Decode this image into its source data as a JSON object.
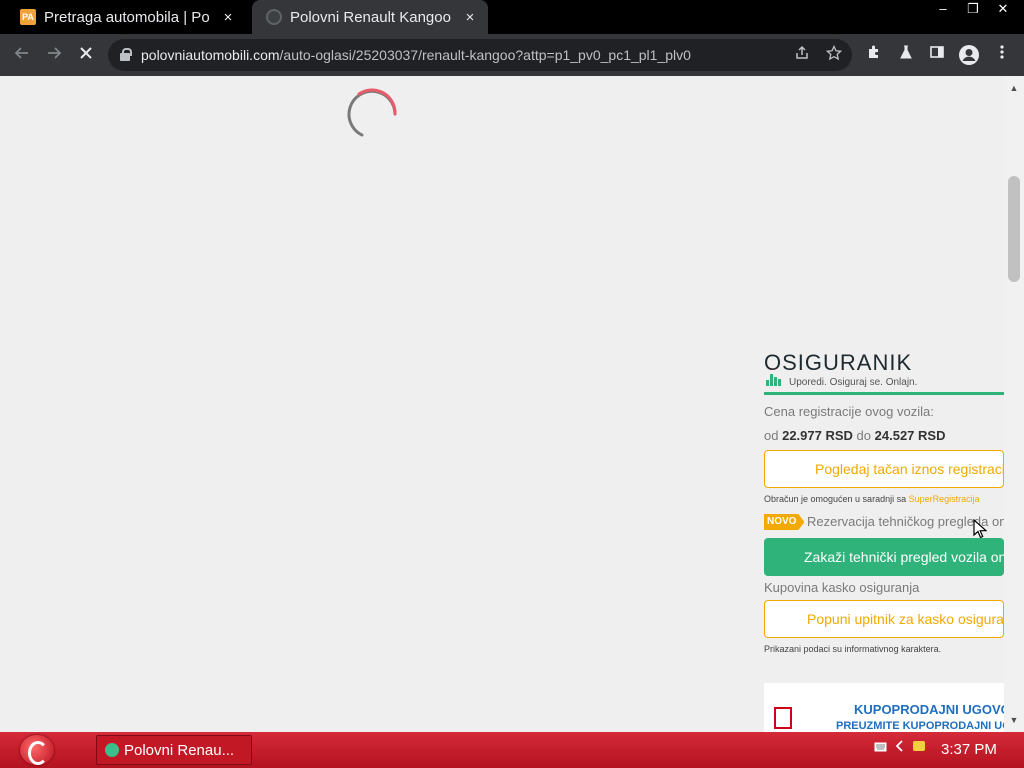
{
  "browser": {
    "tabs": [
      {
        "title": "Pretraga automobila | Po",
        "favicon_text": "PA",
        "active": false
      },
      {
        "title": "Polovni Renault Kangoo",
        "active": true
      }
    ],
    "tab_close_glyph": "×",
    "window_controls": [
      "–",
      "❐",
      "✕"
    ],
    "url_host": "polovniautomobili.com",
    "url_path": "/auto-oglasi/25203037/renault-kangoo?attp=p1_pv0_pc1_pl1_plv0",
    "icons": {
      "back": "back-arrow-icon",
      "forward": "forward-arrow-icon",
      "stop": "stop-loading-icon",
      "share": "share-icon",
      "star": "bookmark-star-icon",
      "extensions": "puzzle-icon",
      "labs": "flask-icon",
      "sidepanel": "side-panel-icon",
      "profile": "profile-avatar-icon",
      "menu": "kebab-menu-icon"
    }
  },
  "page": {
    "loading": true,
    "osiguranik": {
      "logo_text": "OSIGURANIK",
      "tagline": "Uporedi. Osiguraj se. Onlajn.",
      "reg_label": "Cena registracije ovog vozila:",
      "reg_from_word": "od",
      "reg_min": "22.977 RSD",
      "reg_to_word": "do",
      "reg_max": "24.527 RSD",
      "reg_button": "Pogledaj tačan iznos registracije",
      "reg_note_prefix": "Obračun je omogućen u saradnji sa",
      "reg_note_link": "SuperRegistracija",
      "novo_badge": "NOVO",
      "tp_text": "Rezervacija tehničkog pregleda online",
      "tp_button": "Zakaži tehnički pregled vozila online",
      "kasko_label": "Kupovina kasko osiguranja",
      "kasko_button": "Popuni upitnik za kasko osiguranje",
      "disclaimer": "Prikazani podaci su informativnog karaktera."
    },
    "contract_card": {
      "title": "KUPOPRODAJNI UGOVOR",
      "subtitle": "PREUZMITE KUPOPRODAJNI UGOVOR"
    },
    "colors": {
      "brand_green": "#2fb37a",
      "accent_orange": "#f2a900",
      "contract_blue": "#1e6fc0"
    }
  },
  "taskbar": {
    "task_label": "Polovni Renau...",
    "clock": "3:37 PM"
  }
}
